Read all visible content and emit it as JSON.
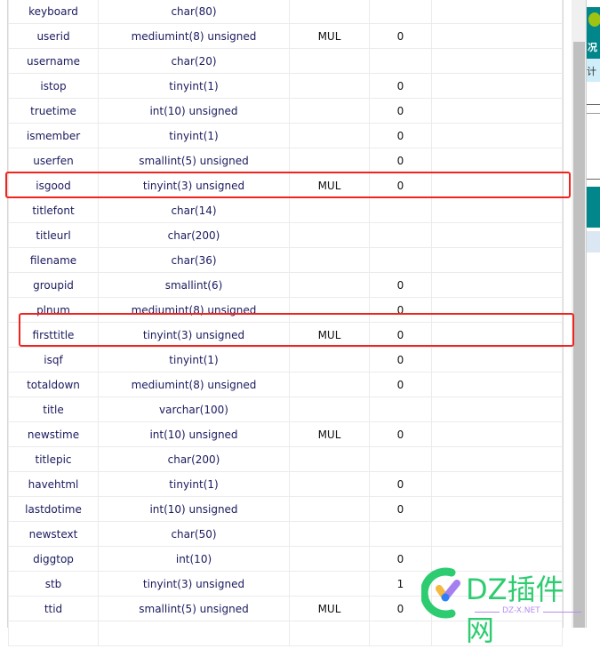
{
  "table": {
    "rows": [
      {
        "field": "keyboard",
        "type": "char(80)",
        "key": "",
        "default": "",
        "extra": ""
      },
      {
        "field": "userid",
        "type": "mediumint(8) unsigned",
        "key": "MUL",
        "default": "0",
        "extra": ""
      },
      {
        "field": "username",
        "type": "char(20)",
        "key": "",
        "default": "",
        "extra": ""
      },
      {
        "field": "istop",
        "type": "tinyint(1)",
        "key": "",
        "default": "0",
        "extra": ""
      },
      {
        "field": "truetime",
        "type": "int(10) unsigned",
        "key": "",
        "default": "0",
        "extra": ""
      },
      {
        "field": "ismember",
        "type": "tinyint(1)",
        "key": "",
        "default": "0",
        "extra": ""
      },
      {
        "field": "userfen",
        "type": "smallint(5) unsigned",
        "key": "",
        "default": "0",
        "extra": ""
      },
      {
        "field": "isgood",
        "type": "tinyint(3) unsigned",
        "key": "MUL",
        "default": "0",
        "extra": "",
        "highlighted": true
      },
      {
        "field": "titlefont",
        "type": "char(14)",
        "key": "",
        "default": "",
        "extra": ""
      },
      {
        "field": "titleurl",
        "type": "char(200)",
        "key": "",
        "default": "",
        "extra": ""
      },
      {
        "field": "filename",
        "type": "char(36)",
        "key": "",
        "default": "",
        "extra": ""
      },
      {
        "field": "groupid",
        "type": "smallint(6)",
        "key": "",
        "default": "0",
        "extra": ""
      },
      {
        "field": "plnum",
        "type": "mediumint(8) unsigned",
        "key": "",
        "default": "0",
        "extra": ""
      },
      {
        "field": "firsttitle",
        "type": "tinyint(3) unsigned",
        "key": "MUL",
        "default": "0",
        "extra": "",
        "highlighted": true
      },
      {
        "field": "isqf",
        "type": "tinyint(1)",
        "key": "",
        "default": "0",
        "extra": ""
      },
      {
        "field": "totaldown",
        "type": "mediumint(8) unsigned",
        "key": "",
        "default": "0",
        "extra": ""
      },
      {
        "field": "title",
        "type": "varchar(100)",
        "key": "",
        "default": "",
        "extra": ""
      },
      {
        "field": "newstime",
        "type": "int(10) unsigned",
        "key": "MUL",
        "default": "0",
        "extra": ""
      },
      {
        "field": "titlepic",
        "type": "char(200)",
        "key": "",
        "default": "",
        "extra": ""
      },
      {
        "field": "havehtml",
        "type": "tinyint(1)",
        "key": "",
        "default": "0",
        "extra": ""
      },
      {
        "field": "lastdotime",
        "type": "int(10) unsigned",
        "key": "",
        "default": "0",
        "extra": ""
      },
      {
        "field": "newstext",
        "type": "char(50)",
        "key": "",
        "default": "",
        "extra": ""
      },
      {
        "field": "diggtop",
        "type": "int(10)",
        "key": "",
        "default": "0",
        "extra": ""
      },
      {
        "field": "stb",
        "type": "tinyint(3) unsigned",
        "key": "",
        "default": "1",
        "extra": ""
      },
      {
        "field": "ttid",
        "type": "smallint(5) unsigned",
        "key": "MUL",
        "default": "0",
        "extra": ""
      },
      {
        "field": "",
        "type": "",
        "key": "",
        "default": "",
        "extra": ""
      }
    ]
  },
  "background_window": {
    "text_1": "况",
    "text_2": "计"
  },
  "watermark": {
    "title": "DZ插件网",
    "subtitle": "DZ-X.NET"
  },
  "colors": {
    "highlight": "#f2231e",
    "field_text": "#1a1a5e",
    "teal": "#00868b",
    "watermark_green": "#2ecc71",
    "watermark_purple": "#b48cf0"
  }
}
